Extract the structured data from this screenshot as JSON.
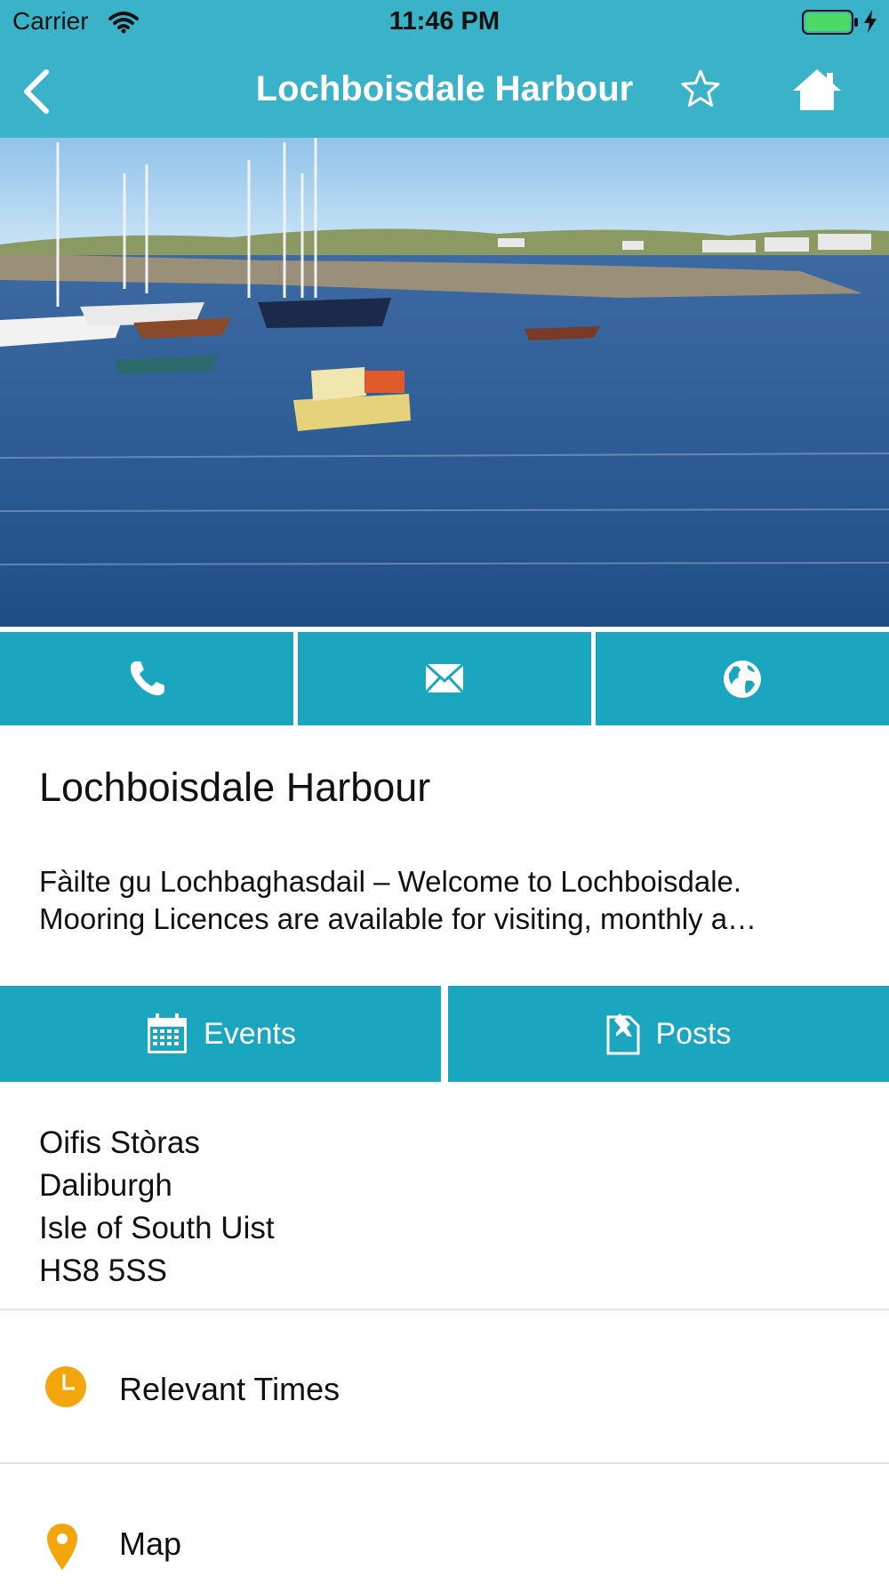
{
  "status": {
    "carrier": "Carrier",
    "time": "11:46 PM"
  },
  "nav": {
    "title": "Lochboisdale Harbour"
  },
  "place": {
    "title": "Lochboisdale Harbour",
    "description_line1": "Fàilte gu Lochbaghasdail – Welcome to Lochboisdale.",
    "description_line2": "Mooring Licences are available for visiting, monthly a…"
  },
  "tabs": {
    "events": "Events",
    "posts": "Posts"
  },
  "address": {
    "line1": "Oifis Stòras",
    "line2": "Daliburgh",
    "line3": "Isle of South Uist",
    "line4": "HS8 5SS"
  },
  "rows": {
    "times": "Relevant Times",
    "map": "Map"
  },
  "colors": {
    "header": "#3ab2c7",
    "button": "#1ba6c0",
    "accent_orange": "#f2a60c"
  }
}
